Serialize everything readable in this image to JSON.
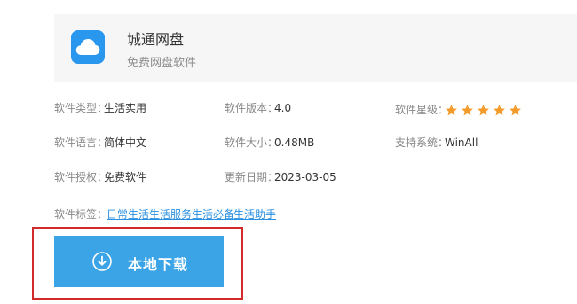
{
  "app": {
    "name": "城通网盘",
    "subtitle": "免费网盘软件",
    "icon": "cloud-icon",
    "icon_color": "#2a97ee"
  },
  "info": {
    "type_label": "软件类型：",
    "type_value": "生活实用",
    "version_label": "软件版本：",
    "version_value": "4.0",
    "rating_label": "软件星级：",
    "rating_stars": 5,
    "language_label": "软件语言：",
    "language_value": "简体中文",
    "size_label": "软件大小：",
    "size_value": "0.48MB",
    "system_label": "支持系统：",
    "system_value": "WinAll",
    "license_label": "软件授权：",
    "license_value": "免费软件",
    "date_label": "更新日期：",
    "date_value": "2023-03-05"
  },
  "tags": {
    "label": "软件标签：",
    "items": [
      "日常生活",
      "生活服务",
      "生活必备",
      "生活助手"
    ],
    "color": "#2a8fe0"
  },
  "download": {
    "label": "本地下载",
    "icon": "download-arrow-icon",
    "color": "#3aa4e6"
  },
  "highlight_color": "#d22b2b",
  "star_color": "#f39c2b"
}
